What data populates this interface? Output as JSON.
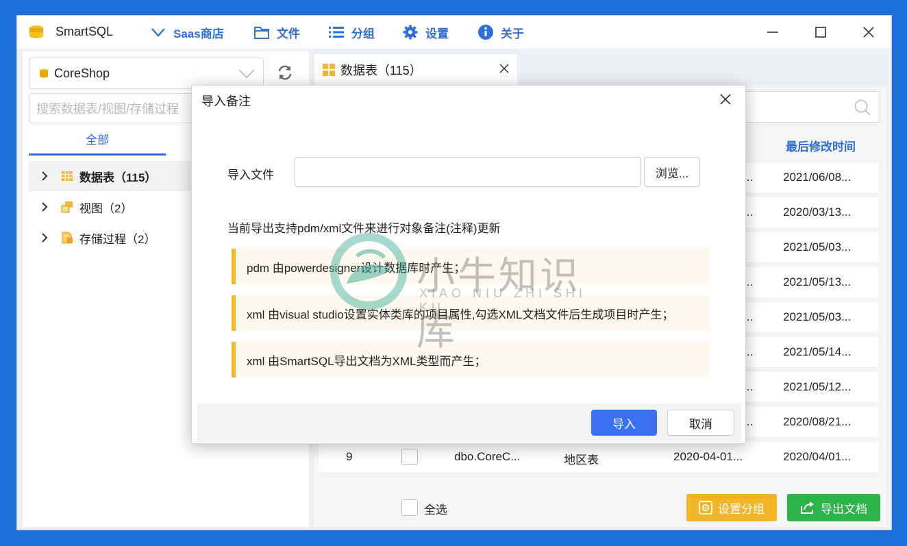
{
  "titlebar": {
    "app_title": "SmartSQL",
    "menu": [
      {
        "label": "Saas商店",
        "icon": "chevron-down-icon"
      },
      {
        "label": "文件",
        "icon": "folder-icon"
      },
      {
        "label": "分组",
        "icon": "list-icon"
      },
      {
        "label": "设置",
        "icon": "gear-icon"
      },
      {
        "label": "关于",
        "icon": "info-icon"
      }
    ]
  },
  "sidebar": {
    "database": "CoreShop",
    "search_placeholder": "搜索数据表/视图/存储过程",
    "tab_all": "全部",
    "tree": [
      {
        "label": "数据表（115）"
      },
      {
        "label": "视图（2）"
      },
      {
        "label": "存储过程（2）"
      }
    ]
  },
  "main": {
    "tab_label": "数据表（115）",
    "last_modified_header": "最后修改时间",
    "rows": [
      {
        "partial": "...",
        "modified": "2021/06/08..."
      },
      {
        "partial": "...",
        "modified": "2020/03/13..."
      },
      {
        "partial": "",
        "modified": "2021/05/03..."
      },
      {
        "partial": "...",
        "modified": "2021/05/13..."
      },
      {
        "partial": "...",
        "modified": "2021/05/03..."
      },
      {
        "partial": "...",
        "modified": "2021/05/14..."
      },
      {
        "partial": "...",
        "modified": "2021/05/12..."
      },
      {
        "partial": "...",
        "modified": "2020/08/21..."
      },
      {
        "no": "9",
        "name": "dbo.CoreC...",
        "comment": "地区表",
        "created": "2020-04-01...",
        "modified": "2020/04/01..."
      }
    ],
    "select_all": "全选",
    "set_group_button": "设置分组",
    "export_doc_button": "导出文档"
  },
  "dialog": {
    "title": "导入备注",
    "file_label": "导入文件",
    "file_value": "",
    "browse_button": "浏览...",
    "description": "当前导出支持pdm/xml文件来进行对象备注(注释)更新",
    "notes": [
      "pdm 由powerdesigner设计数据库时产生；",
      "xml 由visual studio设置实体类库的项目属性,勾选XML文档文件后生成项目时产生；",
      "xml 由SmartSQL导出文档为XML类型而产生；"
    ],
    "ok_button": "导入",
    "cancel_button": "取消"
  },
  "watermark": {
    "cn": "小牛知识库",
    "en": "XIAO NIU ZHI SHI KU"
  },
  "colors": {
    "accent": "#2f6fd8",
    "primary_button": "#3a6ff0",
    "warning": "#f1b62a",
    "success": "#2cb34a",
    "background": "#1e6fd9"
  }
}
